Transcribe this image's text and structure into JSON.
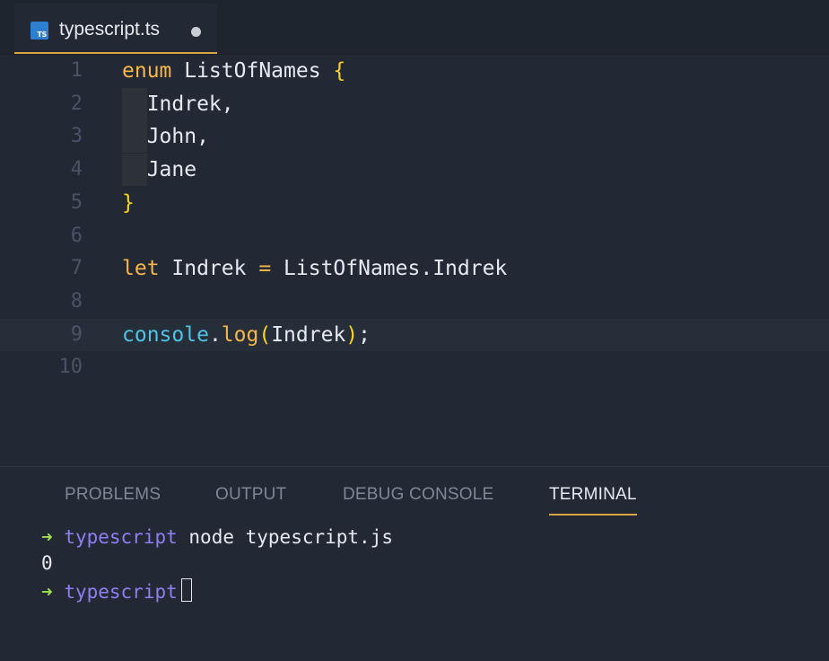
{
  "tab": {
    "title": "typescript.ts",
    "icon_text": "TS",
    "icon": "typescript-file-icon",
    "modified": true
  },
  "editor": {
    "lines": [
      {
        "num": "1",
        "parts": [
          {
            "t": "enum",
            "c": "k"
          },
          {
            "t": " ListOfNames ",
            "c": "p"
          },
          {
            "t": "{",
            "c": "b"
          }
        ]
      },
      {
        "num": "2",
        "parts": [
          {
            "t": "  Indrek,",
            "c": "p"
          }
        ]
      },
      {
        "num": "3",
        "parts": [
          {
            "t": "  John,",
            "c": "p"
          }
        ]
      },
      {
        "num": "4",
        "parts": [
          {
            "t": "  Jane",
            "c": "p"
          }
        ]
      },
      {
        "num": "5",
        "parts": [
          {
            "t": "}",
            "c": "b"
          }
        ]
      },
      {
        "num": "6",
        "parts": []
      },
      {
        "num": "7",
        "parts": [
          {
            "t": "let",
            "c": "k"
          },
          {
            "t": " Indrek ",
            "c": "p"
          },
          {
            "t": "=",
            "c": "k"
          },
          {
            "t": " ListOfNames.Indrek",
            "c": "p"
          }
        ]
      },
      {
        "num": "8",
        "parts": []
      },
      {
        "num": "9",
        "parts": [
          {
            "t": "console",
            "c": "f"
          },
          {
            "t": ".",
            "c": "p"
          },
          {
            "t": "log",
            "c": "k"
          },
          {
            "t": "(",
            "c": "b"
          },
          {
            "t": "Indrek",
            "c": "p"
          },
          {
            "t": ")",
            "c": "b"
          },
          {
            "t": ";",
            "c": "p"
          }
        ]
      },
      {
        "num": "10",
        "parts": []
      }
    ]
  },
  "panel": {
    "tabs": [
      {
        "label": "PROBLEMS",
        "active": false
      },
      {
        "label": "OUTPUT",
        "active": false
      },
      {
        "label": "DEBUG CONSOLE",
        "active": false
      },
      {
        "label": "TERMINAL",
        "active": true
      }
    ]
  },
  "terminal": {
    "prompt_symbol": "➜",
    "directory": "typescript",
    "command": "node typescript.js",
    "output": "0"
  },
  "colors": {
    "keyword": "#f7b64a",
    "bracket": "#ffd21e",
    "function": "#4fc3e6",
    "accent": "#d9a441",
    "prompt": "#9ee04f",
    "directory": "#8d7ff3"
  }
}
